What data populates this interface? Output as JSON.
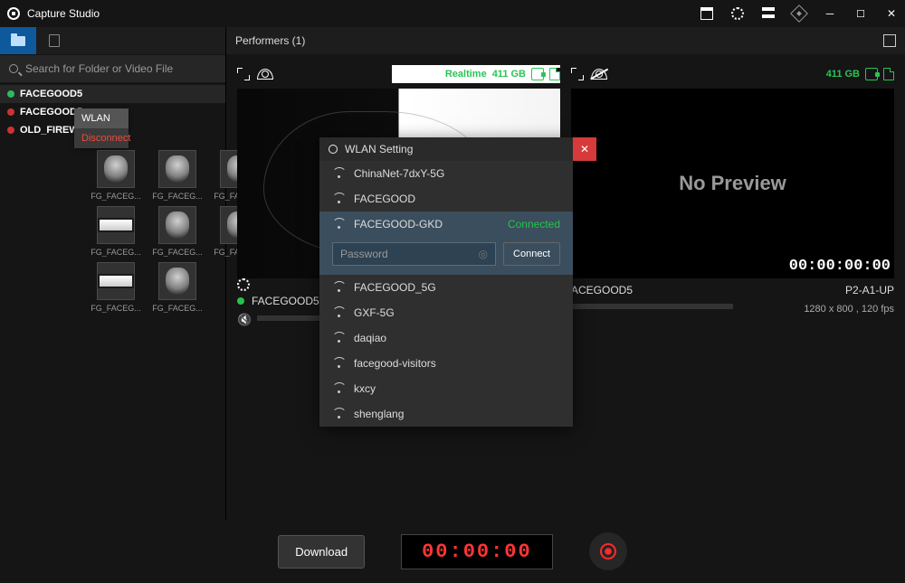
{
  "app": {
    "title": "Capture Studio"
  },
  "search": {
    "placeholder": "Search for Folder or Video File"
  },
  "ctx": {
    "wlan": "WLAN",
    "disconnect": "Disconnect"
  },
  "devices": [
    {
      "name": "FACEGOOD5",
      "online": true
    },
    {
      "name": "FACEGOOD5",
      "online": false
    },
    {
      "name": "OLD_FIREWARE",
      "online": false
    }
  ],
  "gallery": {
    "items": [
      {
        "label": "FG_FACEG..."
      },
      {
        "label": "FG_FACEG..."
      },
      {
        "label": "FG_FACEG..."
      },
      {
        "label": "FG_FACEG..."
      },
      {
        "label": "FG_FACEG..."
      },
      {
        "label": "FG_FACEG..."
      },
      {
        "label": "FG_FACEG..."
      },
      {
        "label": "FG_FACEG..."
      }
    ]
  },
  "content": {
    "header": "Performers (1)"
  },
  "previews": {
    "left": {
      "realtime": "Realtime",
      "storage": "411 GB",
      "name": "FACEGOOD5"
    },
    "right": {
      "storage": "411 GB",
      "placeholder": "No Preview",
      "timecode": "00:00:00:00",
      "name": "ACEGOOD5",
      "pose": "P2-A1-UP",
      "res": "1280 x 800 , 120 fps"
    }
  },
  "bottom": {
    "download": "Download",
    "timer": "00:00:00"
  },
  "dialog": {
    "title": "WLAN Setting",
    "connected_label": "Connected",
    "password_placeholder": "Password",
    "connect": "Connect",
    "networks": [
      {
        "ssid": "ChinaNet-7dxY-5G"
      },
      {
        "ssid": "FACEGOOD"
      },
      {
        "ssid": "FACEGOOD-GKD"
      },
      {
        "ssid": "FACEGOOD_5G"
      },
      {
        "ssid": "GXF-5G"
      },
      {
        "ssid": "daqiao"
      },
      {
        "ssid": "facegood-visitors"
      },
      {
        "ssid": "kxcy"
      },
      {
        "ssid": "shenglang"
      }
    ]
  }
}
